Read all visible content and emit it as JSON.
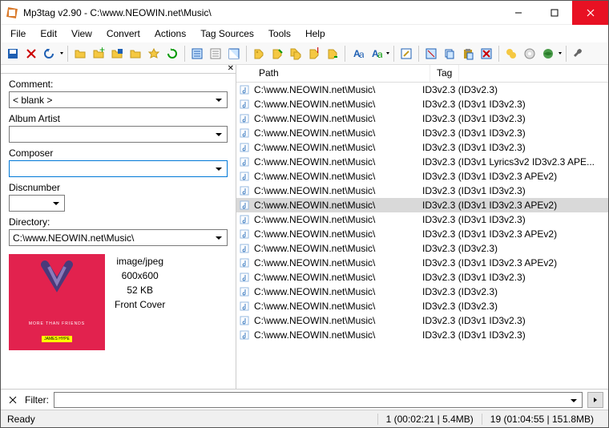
{
  "title": "Mp3tag v2.90  -  C:\\www.NEOWIN.net\\Music\\",
  "menus": [
    "File",
    "Edit",
    "View",
    "Convert",
    "Actions",
    "Tag Sources",
    "Tools",
    "Help"
  ],
  "fields": {
    "comment": {
      "label": "Comment:",
      "value": "< blank >"
    },
    "albumartist": {
      "label": "Album Artist",
      "value": ""
    },
    "composer": {
      "label": "Composer",
      "value": ""
    },
    "discnumber": {
      "label": "Discnumber",
      "value": ""
    },
    "directory": {
      "label": "Directory:",
      "value": "C:\\www.NEOWIN.net\\Music\\"
    }
  },
  "cover": {
    "mime": "image/jpeg",
    "dims": "600x600",
    "size": "52 KB",
    "type": "Front Cover",
    "text1": "MORE THAN FRIENDS",
    "text2": "JAMES HYPE"
  },
  "columns": {
    "path": "Path",
    "tag": "Tag"
  },
  "rows": [
    {
      "path": "C:\\www.NEOWIN.net\\Music\\",
      "tag": "ID3v2.3 (ID3v2.3)"
    },
    {
      "path": "C:\\www.NEOWIN.net\\Music\\",
      "tag": "ID3v2.3 (ID3v1 ID3v2.3)"
    },
    {
      "path": "C:\\www.NEOWIN.net\\Music\\",
      "tag": "ID3v2.3 (ID3v1 ID3v2.3)"
    },
    {
      "path": "C:\\www.NEOWIN.net\\Music\\",
      "tag": "ID3v2.3 (ID3v1 ID3v2.3)"
    },
    {
      "path": "C:\\www.NEOWIN.net\\Music\\",
      "tag": "ID3v2.3 (ID3v1 ID3v2.3)"
    },
    {
      "path": "C:\\www.NEOWIN.net\\Music\\",
      "tag": "ID3v2.3 (ID3v1 Lyrics3v2 ID3v2.3 APE..."
    },
    {
      "path": "C:\\www.NEOWIN.net\\Music\\",
      "tag": "ID3v2.3 (ID3v1 ID3v2.3 APEv2)"
    },
    {
      "path": "C:\\www.NEOWIN.net\\Music\\",
      "tag": "ID3v2.3 (ID3v1 ID3v2.3)"
    },
    {
      "path": "C:\\www.NEOWIN.net\\Music\\",
      "tag": "ID3v2.3 (ID3v1 ID3v2.3 APEv2)",
      "selected": true
    },
    {
      "path": "C:\\www.NEOWIN.net\\Music\\",
      "tag": "ID3v2.3 (ID3v1 ID3v2.3)"
    },
    {
      "path": "C:\\www.NEOWIN.net\\Music\\",
      "tag": "ID3v2.3 (ID3v1 ID3v2.3 APEv2)"
    },
    {
      "path": "C:\\www.NEOWIN.net\\Music\\",
      "tag": "ID3v2.3 (ID3v2.3)"
    },
    {
      "path": "C:\\www.NEOWIN.net\\Music\\",
      "tag": "ID3v2.3 (ID3v1 ID3v2.3 APEv2)"
    },
    {
      "path": "C:\\www.NEOWIN.net\\Music\\",
      "tag": "ID3v2.3 (ID3v1 ID3v2.3)"
    },
    {
      "path": "C:\\www.NEOWIN.net\\Music\\",
      "tag": "ID3v2.3 (ID3v2.3)"
    },
    {
      "path": "C:\\www.NEOWIN.net\\Music\\",
      "tag": "ID3v2.3 (ID3v2.3)"
    },
    {
      "path": "C:\\www.NEOWIN.net\\Music\\",
      "tag": "ID3v2.3 (ID3v1 ID3v2.3)"
    },
    {
      "path": "C:\\www.NEOWIN.net\\Music\\",
      "tag": "ID3v2.3 (ID3v1 ID3v2.3)"
    }
  ],
  "filter": {
    "label": "Filter:",
    "value": ""
  },
  "status": {
    "ready": "Ready",
    "sel": "1 (00:02:21 | 5.4MB)",
    "total": "19 (01:04:55 | 151.8MB)"
  }
}
